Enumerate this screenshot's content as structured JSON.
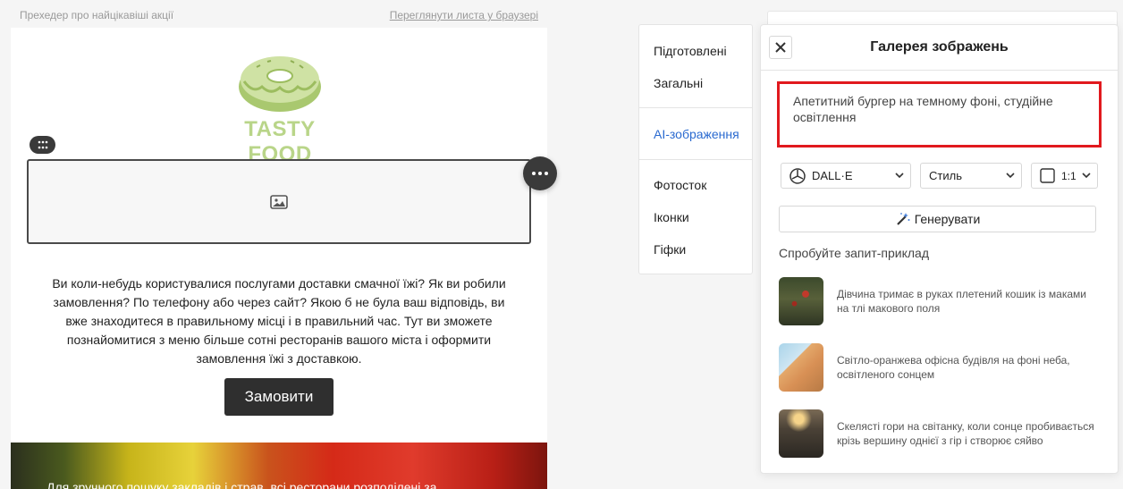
{
  "email": {
    "preheader": "Прехедер про найцікавіші акції",
    "browser_link": "Переглянути листа у браузері",
    "logo_text": "TASTY FOOD",
    "body_text": "Ви коли-небудь користувалися послугами доставки смачної їжі? Як ви робили замовлення? По телефону або через сайт? Якою б не була ваш відповідь, ви вже знаходитеся в правильному місці і в правильний час. Тут ви зможете познайомитися з меню більше сотні ресторанів вашого міста і оформити замовлення їжі з доставкою.",
    "order_button": "Замовити",
    "bottom_text": "Для зручного пошуку закладів і страв, всі ресторани розподілені за"
  },
  "categories": {
    "items": [
      {
        "label": "Підготовлені"
      },
      {
        "label": "Загальні"
      },
      {
        "label": "AI-зображення",
        "active": true
      },
      {
        "label": "Фотосток"
      },
      {
        "label": "Іконки"
      },
      {
        "label": "Гіфки"
      }
    ]
  },
  "gallery": {
    "title": "Галерея зображень",
    "prompt": "Апетитний бургер на темному фоні, студійне освітлення",
    "model_select": "DALL·E",
    "style_select": "Стиль",
    "ratio_select": "1:1",
    "generate_button": "Генерувати",
    "try_label": "Спробуйте запит-приклад",
    "examples": [
      {
        "text": "Дівчина тримає в руках плетений кошик із маками на тлі макового поля"
      },
      {
        "text": "Світло-оранжева офісна будівля на фоні неба, освітленого сонцем"
      },
      {
        "text": "Скелясті гори на світанку, коли сонце пробивається крізь вершину однієї з гір і створює сяйво"
      }
    ]
  },
  "colors": {
    "accent": "#2a6ad0",
    "highlight_border": "#e1191e",
    "logo_green": "#b9d589",
    "dark_button": "#2f2f2f"
  }
}
